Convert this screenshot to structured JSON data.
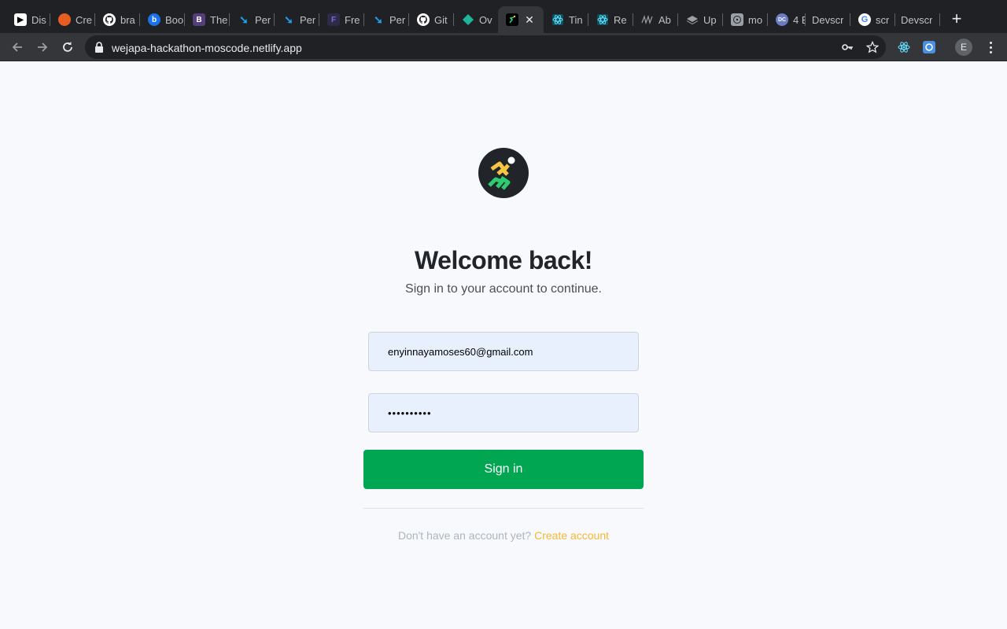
{
  "browser": {
    "tabs": [
      {
        "title": "Dis",
        "favicon": "dark-app-icon",
        "color": "#000000"
      },
      {
        "title": "Cre",
        "favicon": "orange-flame-icon",
        "color": "#e85d22"
      },
      {
        "title": "bra",
        "favicon": "github-icon",
        "color": "#ffffff"
      },
      {
        "title": "Boo",
        "favicon": "b-blue-icon",
        "color": "#1a73e8"
      },
      {
        "title": "The",
        "favicon": "bootstrap-icon",
        "color": "#563d7c"
      },
      {
        "title": "Per",
        "favicon": "blue-bird-icon",
        "color": "#1da1f2"
      },
      {
        "title": "Per",
        "favicon": "blue-bird-icon",
        "color": "#1da1f2"
      },
      {
        "title": "Fre",
        "favicon": "framer-icon",
        "color": "#2e2a4a"
      },
      {
        "title": "Per",
        "favicon": "blue-bird-icon",
        "color": "#1da1f2"
      },
      {
        "title": "Git",
        "favicon": "github-icon",
        "color": "#ffffff"
      },
      {
        "title": "Ov",
        "favicon": "teal-diamond-icon",
        "color": "#1fb59a"
      },
      {
        "title": "",
        "favicon": "runner-icon",
        "color": "#000000",
        "active": true
      },
      {
        "title": "Tin",
        "favicon": "react-icon",
        "color": "#61dafb"
      },
      {
        "title": "Re",
        "favicon": "react-icon",
        "color": "#61dafb"
      },
      {
        "title": "Ab",
        "favicon": "scribble-icon",
        "color": "#202124"
      },
      {
        "title": "Up",
        "favicon": "layers-icon",
        "color": "#9aa0a6"
      },
      {
        "title": "mo",
        "favicon": "atom-gray-icon",
        "color": "#9aa0a6"
      },
      {
        "title": "4 E",
        "favicon": "dc-icon",
        "color": "#6b7cc4"
      },
      {
        "title": "Devscr",
        "favicon": "",
        "color": ""
      },
      {
        "title": "scr",
        "favicon": "google-icon",
        "color": "#ffffff"
      },
      {
        "title": "Devscr",
        "favicon": "",
        "color": ""
      }
    ],
    "url": "wejapa-hackathon-moscode.netlify.app",
    "profile_initial": "E"
  },
  "page": {
    "heading": "Welcome back!",
    "subheading": "Sign in to your account to continue.",
    "email_value": "enyinnayamoses60@gmail.com",
    "password_value": "••••••••••",
    "signin_label": "Sign in",
    "footer_text": "Don't have an account yet?",
    "footer_link": "Create account"
  },
  "colors": {
    "primary": "#00a651",
    "accent": "#f7b731",
    "logo_bg": "#212529",
    "logo_yellow": "#f7c543",
    "logo_green": "#2ecc71"
  }
}
